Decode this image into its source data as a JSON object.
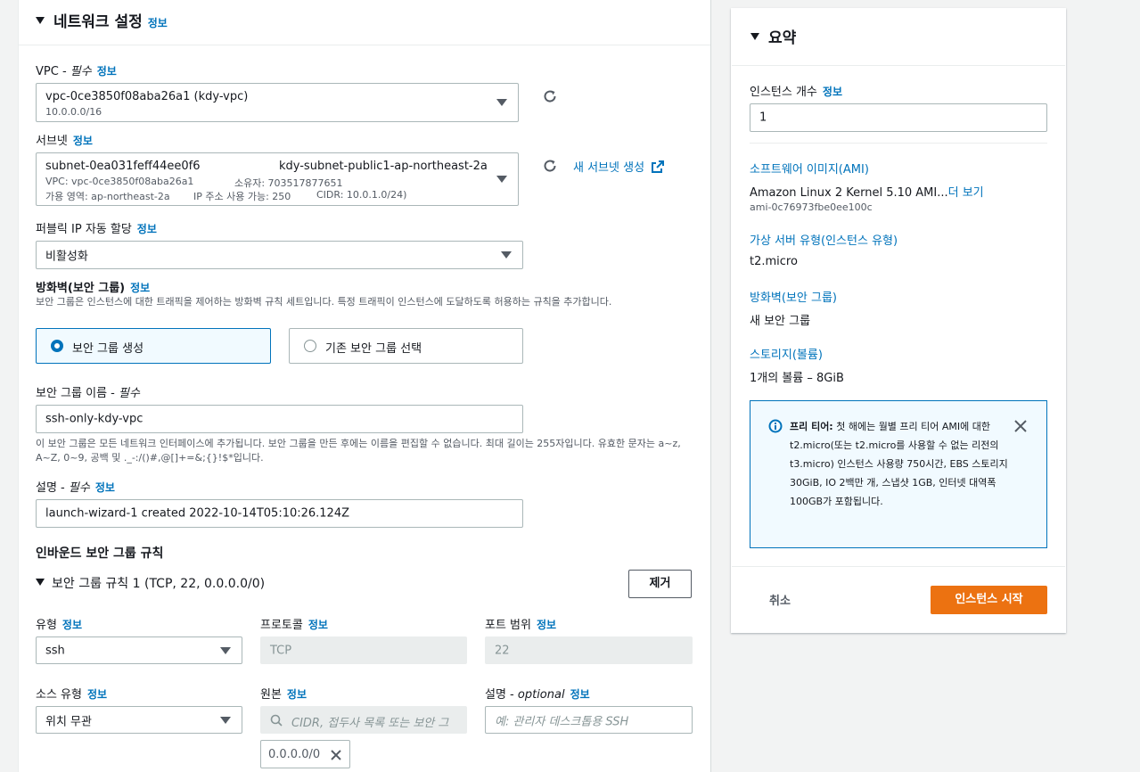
{
  "network": {
    "title": "네트워크 설정",
    "info": "정보",
    "vpc": {
      "label": "VPC - ",
      "required": "필수",
      "info": "정보",
      "value": "vpc-0ce3850f08aba26a1 (kdy-vpc)",
      "sub": "10.0.0.0/16"
    },
    "subnet": {
      "label": "서브넷",
      "info": "정보",
      "id": "subnet-0ea031feff44ee0f6",
      "name": "kdy-subnet-public1-ap-northeast-2a",
      "vpc_line": "VPC: vpc-0ce3850f08aba26a1",
      "owner_line": "소유자: 703517877651",
      "az_line": "가용 영역: ap-northeast-2a",
      "ip_line": "IP 주소 사용 가능: 250",
      "cidr_line": "CIDR: 10.0.1.0/24)",
      "create_link": "새 서브넷 생성"
    },
    "public_ip": {
      "label": "퍼블릭 IP 자동 할당",
      "info": "정보",
      "value": "비활성화"
    },
    "firewall": {
      "label": "방화벽(보안 그룹)",
      "info": "정보",
      "description": "보안 그룹은 인스턴스에 대한 트래픽을 제어하는 방화벽 규칙 세트입니다. 특정 트래픽이 인스턴스에 도달하도록 허용하는 규칙을 추가합니다.",
      "option_create": "보안 그룹 생성",
      "option_existing": "기존 보안 그룹 선택"
    },
    "sg_name": {
      "label": "보안 그룹 이름 - ",
      "required": "필수",
      "value": "ssh-only-kdy-vpc",
      "help": "이 보안 그룹은 모든 네트워크 인터페이스에 추가됩니다. 보안 그룹을 만든 후에는 이름을 편집할 수 없습니다. 최대 길이는 255자입니다. 유효한 문자는 a~z, A~Z, 0~9, 공백 및 ._-:/()#,@[]+=&;{}!$*입니다."
    },
    "sg_desc": {
      "label": "설명 - ",
      "required": "필수",
      "info": "정보",
      "value": "launch-wizard-1 created 2022-10-14T05:10:26.124Z"
    },
    "inbound": {
      "title": "인바운드 보안 그룹 규칙",
      "rule_title": "보안 그룹 규칙 1 (TCP, 22, 0.0.0.0/0)",
      "remove": "제거",
      "type_label": "유형",
      "type_info": "정보",
      "type_value": "ssh",
      "protocol_label": "프로토콜",
      "protocol_info": "정보",
      "protocol_value": "TCP",
      "port_label": "포트 범위",
      "port_info": "정보",
      "port_value": "22",
      "source_type_label": "소스 유형",
      "source_type_info": "정보",
      "source_type_value": "위치 무관",
      "source_label": "원본",
      "source_info": "정보",
      "source_placeholder": "CIDR, 접두사 목록 또는 보안 그",
      "source_tag": "0.0.0.0/0",
      "desc_label": "설명 - ",
      "desc_optional": "optional",
      "desc_info": "정보",
      "desc_placeholder": "예: 관리자 데스크톱용 SSH"
    }
  },
  "summary": {
    "title": "요약",
    "count_label": "인스턴스 개수",
    "count_info": "정보",
    "count_value": "1",
    "ami_link": "소프트웨어 이미지(AMI)",
    "ami_value": "Amazon Linux 2 Kernel 5.10 AMI...",
    "ami_more": "더 보기",
    "ami_id": "ami-0c76973fbe0ee100c",
    "type_link": "가상 서버 유형(인스턴스 유형)",
    "type_value": "t2.micro",
    "fw_link": "방화벽(보안 그룹)",
    "fw_value": "새 보안 그룹",
    "storage_link": "스토리지(볼륨)",
    "storage_value": "1개의 볼륨 – 8GiB",
    "free_tier_bold": "프리 티어:",
    "free_tier_text": " 첫 해에는 월별 프리 티어 AMI에 대한 t2.micro(또는 t2.micro를 사용할 수 없는 리전의 t3.micro) 인스턴스 사용량 750시간, EBS 스토리지 30GiB, IO 2백만 개, 스냅샷 1GB, 인터넷 대역폭 100GB가 포함됩니다.",
    "cancel": "취소",
    "launch": "인스턴스 시작"
  },
  "colors": {
    "accent": "#0073bb",
    "primary_button": "#ec7211"
  },
  "icons": [
    "refresh-icon",
    "external-link-icon",
    "info-icon",
    "close-icon",
    "dropdown-arrow-icon",
    "search-icon"
  ]
}
